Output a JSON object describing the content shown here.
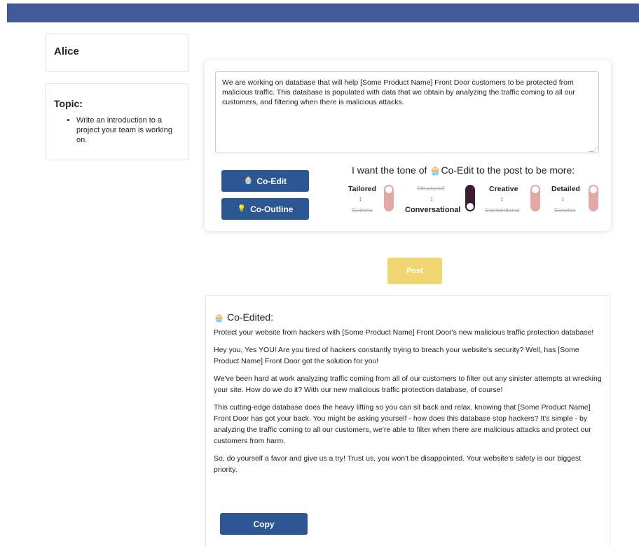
{
  "header": {
    "color": "#415996"
  },
  "user": {
    "name": "Alice"
  },
  "topic": {
    "title": "Topic:",
    "items": [
      "Write an introduction to a project your team is working on."
    ]
  },
  "editor": {
    "text": "We are working on database that will help [Some Product Name] Front Door customers to be protected from malicious traffic. This database is populated with data that we obtain by analyzing the traffic coming to all our customers, and filtering when there is malicious attacks.",
    "coedit_icon": "cake-icon",
    "coedit_label": "Co-Edit",
    "cooutline_icon": "lightbulb-icon",
    "cooutline_label": "Co-Outline",
    "tone_prefix": "I want the tone of ",
    "tone_brand": "Co-Edit",
    "tone_suffix": " to the post to be more:",
    "tones": [
      {
        "top": "Tailored",
        "bottom": "Generic",
        "selected": "top"
      },
      {
        "top": "Structured",
        "bottom": "Conversational",
        "selected": "bottom"
      },
      {
        "top": "Creative",
        "bottom": "Conventional",
        "selected": "top"
      },
      {
        "top": "Detailed",
        "bottom": "Concise",
        "selected": "top"
      }
    ],
    "tone_arrow": "↕"
  },
  "post": {
    "label": "Post",
    "color": "#f0d670"
  },
  "result": {
    "title": "Co-Edited:",
    "paragraphs": [
      "Protect your website from hackers with [Some Product Name] Front Door's new malicious traffic protection database!",
      "Hey you, Yes YOU! Are you tired of hackers constantly trying to breach your website's security? Well, has [Some Product Name] Front Door got the solution for you!",
      "We've been hard at work analyzing traffic coming from all of our customers to filter out any sinister attempts at wrecking your site. How do we do it? With our new malicious traffic protection database, of course!",
      "This cutting-edge database does the heavy lifting so you can sit back and relax, knowing that [Some Product Name] Front Door has got your back. You might be asking yourself - how does this database stop hackers? It's simple - by analyzing the traffic coming to all our customers, we're able to filter when there are malicious attacks and protect our customers from harm.",
      "So, do yourself a favor and give us a try! Trust us, you won't be disappointed. Your website's safety is our biggest priority."
    ],
    "copy_label": "Copy"
  }
}
